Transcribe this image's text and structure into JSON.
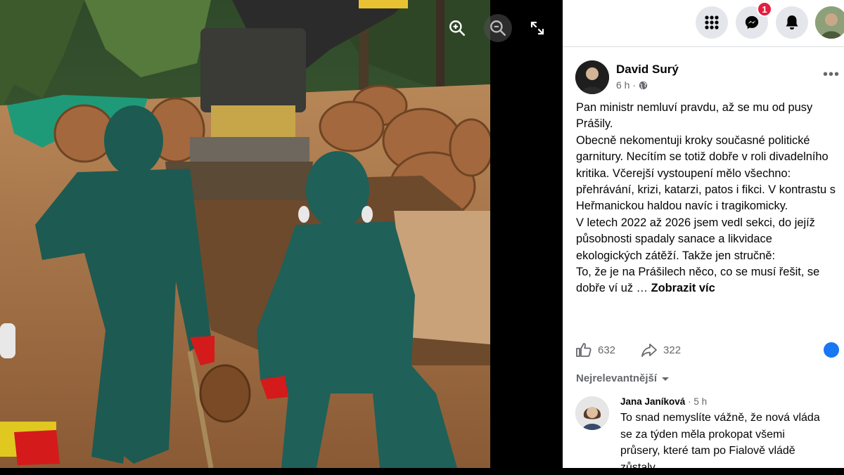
{
  "viewer": {
    "zoom_in_icon": "zoom-in-icon",
    "zoom_out_icon": "zoom-out-icon",
    "fullscreen_icon": "expand-icon"
  },
  "topbar": {
    "menu_icon": "grid-menu-icon",
    "messenger_icon": "messenger-icon",
    "messenger_badge": "1",
    "notifications_icon": "bell-icon"
  },
  "post": {
    "author": "David Surý",
    "time": "6 h",
    "privacy_icon": "globe-icon",
    "paragraphs": [
      "Pan ministr nemluví pravdu, až se mu od pusy Prášily.",
      "Obecně nekomentuji kroky současné politické garnitury. Necítím se totiž dobře v roli divadelního kritika. Včerejší vystoupení mělo všechno: přehrávání, krizi, katarzi, patos i fikci. V kontrastu s Heřmanickou haldou navíc i tragikomicky.",
      "V letech 2022 až 2026 jsem vedl sekci, do jejíž působnosti spadaly sanace a likvidace ekologických zátěží. Takže jen stručně:"
    ],
    "last_line": "To, že je na Prášilech něco, co se musí řešit, se dobře ví už …",
    "see_more": "Zobrazit víc",
    "likes": "632",
    "shares": "322"
  },
  "comments": {
    "sort_label": "Nejrelevantnější",
    "items": [
      {
        "author": "Jana Janíková",
        "time": "5 h",
        "text": "To snad nemyslíte vážně, že nová vláda se za týden měla prokopat všemi průsery, které tam po Fialově vládě zůstaly."
      }
    ]
  },
  "colors": {
    "accent": "#1877f2",
    "badge": "#e41e3f",
    "muted": "#65676b"
  }
}
